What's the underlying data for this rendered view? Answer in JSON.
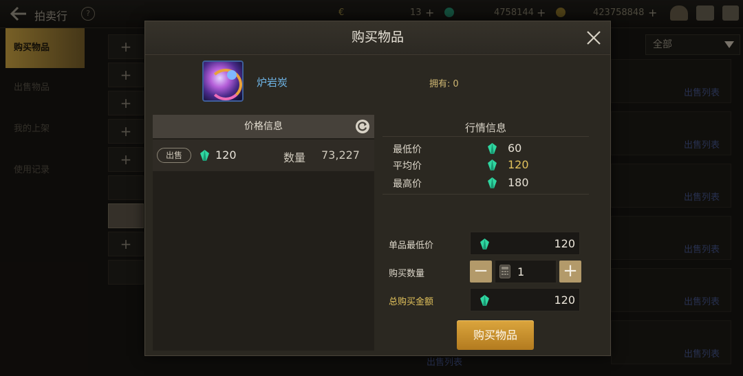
{
  "topbar": {
    "title": "拍卖行",
    "help_glyph": "?",
    "currency1_symbol": "€",
    "currency1": "13",
    "currency2": "4758144",
    "currency3": "423758848",
    "plus": "+"
  },
  "sidebar": {
    "items": [
      "购买物品",
      "出售物品",
      "我的上架",
      "使用记录"
    ]
  },
  "slots": {
    "plus": "+"
  },
  "filter": {
    "label": "全部"
  },
  "right_list": {
    "link_label": "出售列表"
  },
  "modal": {
    "title": "购买物品",
    "item": {
      "name": "炉岩炭",
      "owned_label": "拥有:",
      "owned_value": "0"
    },
    "price_info": {
      "header": "价格信息",
      "listing": {
        "tag": "出售",
        "price": "120",
        "qty_label": "数量",
        "qty": "73,227"
      }
    },
    "market": {
      "header": "行情信息",
      "rows": [
        {
          "label": "最低价",
          "value": "60"
        },
        {
          "label": "平均价",
          "value": "120"
        },
        {
          "label": "最高价",
          "value": "180"
        }
      ]
    },
    "form": {
      "unit_min_label": "单品最低价",
      "unit_min_value": "120",
      "qty_label": "购买数量",
      "qty_value": "1",
      "minus": "−",
      "plus": "+",
      "total_label": "总购买金额",
      "total_value": "120"
    },
    "buy_button": "购买物品"
  },
  "colors": {
    "gold_accent": "#e2c25c",
    "item_name": "#6fb6e8",
    "buy_button": "#c8902e",
    "gem": "#2fd6a0"
  }
}
